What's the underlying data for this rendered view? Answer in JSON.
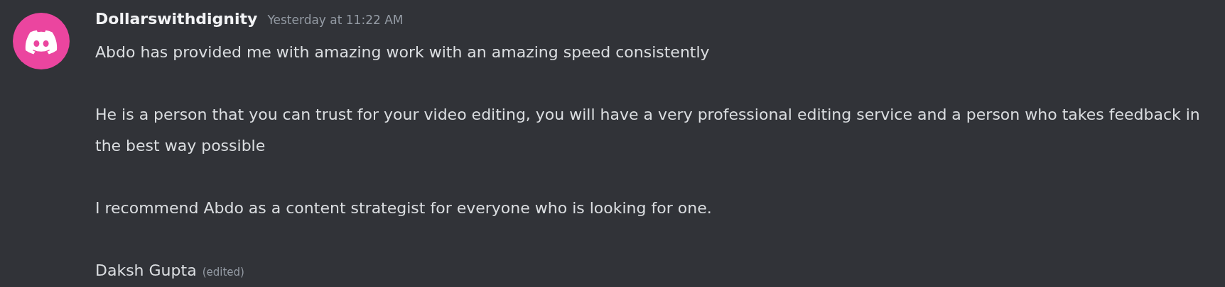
{
  "message": {
    "author": "Dollarswithdignity",
    "timestamp": "Yesterday at 11:22 AM",
    "paragraphs": [
      "Abdo has provided me with amazing work with an amazing speed consistently",
      "He is a person that you can trust for your video editing, you will have a very professional editing service and a person who takes feedback in the best way possible",
      "I recommend Abdo as a content strategist for everyone who is looking for one.",
      "Daksh Gupta"
    ],
    "edited_label": "(edited)"
  }
}
